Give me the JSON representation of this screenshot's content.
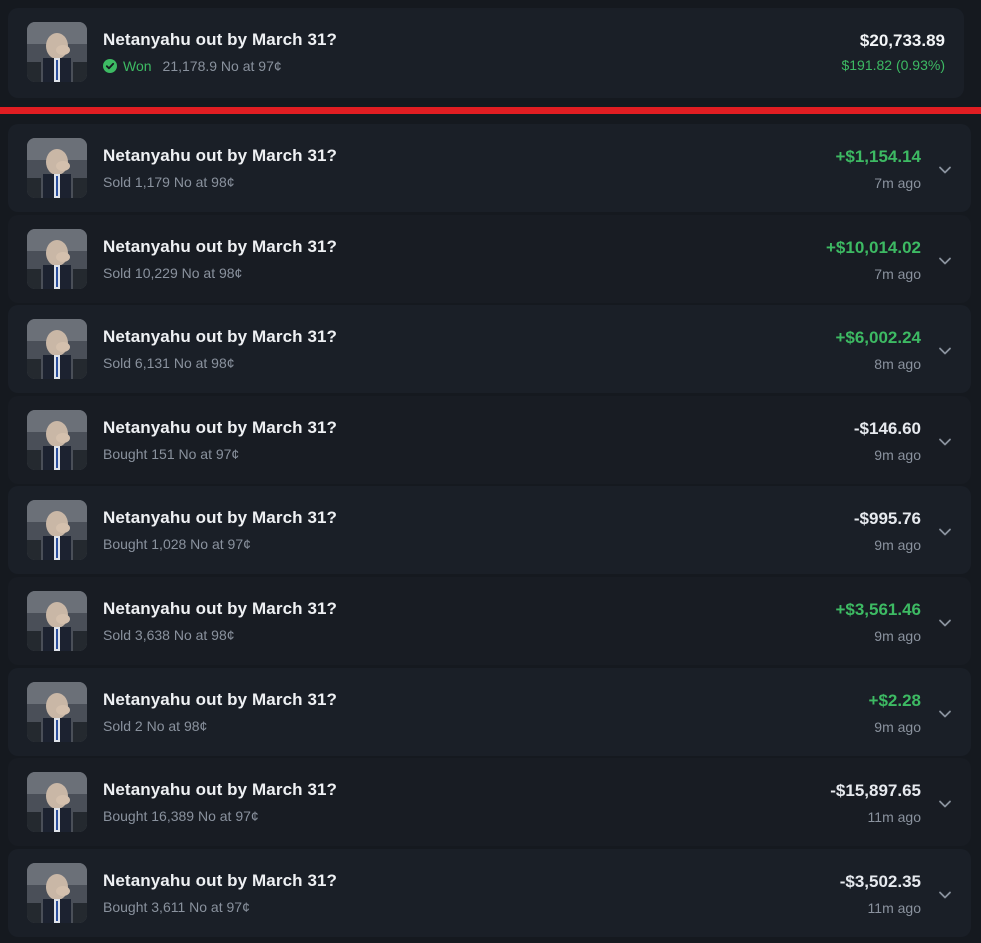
{
  "summary": {
    "title": "Netanyahu out by March 31?",
    "status": "Won",
    "detail": "21,178.9 No at 97¢",
    "value": "$20,733.89",
    "pnl": "$191.82 (0.93%)"
  },
  "colors": {
    "positive": "#3dba63",
    "divider": "#e01d22",
    "background": "#15191f",
    "card": "#1a1f27"
  },
  "activity": [
    {
      "title": "Netanyahu out by March 31?",
      "detail": "Sold 1,179 No at 98¢",
      "amount": "+$1,154.14",
      "time": "7m ago",
      "sign": "pos"
    },
    {
      "title": "Netanyahu out by March 31?",
      "detail": "Sold 10,229 No at 98¢",
      "amount": "+$10,014.02",
      "time": "7m ago",
      "sign": "pos"
    },
    {
      "title": "Netanyahu out by March 31?",
      "detail": "Sold 6,131 No at 98¢",
      "amount": "+$6,002.24",
      "time": "8m ago",
      "sign": "pos"
    },
    {
      "title": "Netanyahu out by March 31?",
      "detail": "Bought 151 No at 97¢",
      "amount": "-$146.60",
      "time": "9m ago",
      "sign": "neg"
    },
    {
      "title": "Netanyahu out by March 31?",
      "detail": "Bought 1,028 No at 97¢",
      "amount": "-$995.76",
      "time": "9m ago",
      "sign": "neg"
    },
    {
      "title": "Netanyahu out by March 31?",
      "detail": "Sold 3,638 No at 98¢",
      "amount": "+$3,561.46",
      "time": "9m ago",
      "sign": "pos"
    },
    {
      "title": "Netanyahu out by March 31?",
      "detail": "Sold 2 No at 98¢",
      "amount": "+$2.28",
      "time": "9m ago",
      "sign": "pos"
    },
    {
      "title": "Netanyahu out by March 31?",
      "detail": "Bought 16,389 No at 97¢",
      "amount": "-$15,897.65",
      "time": "11m ago",
      "sign": "neg"
    },
    {
      "title": "Netanyahu out by March 31?",
      "detail": "Bought 3,611 No at 97¢",
      "amount": "-$3,502.35",
      "time": "11m ago",
      "sign": "neg"
    }
  ]
}
